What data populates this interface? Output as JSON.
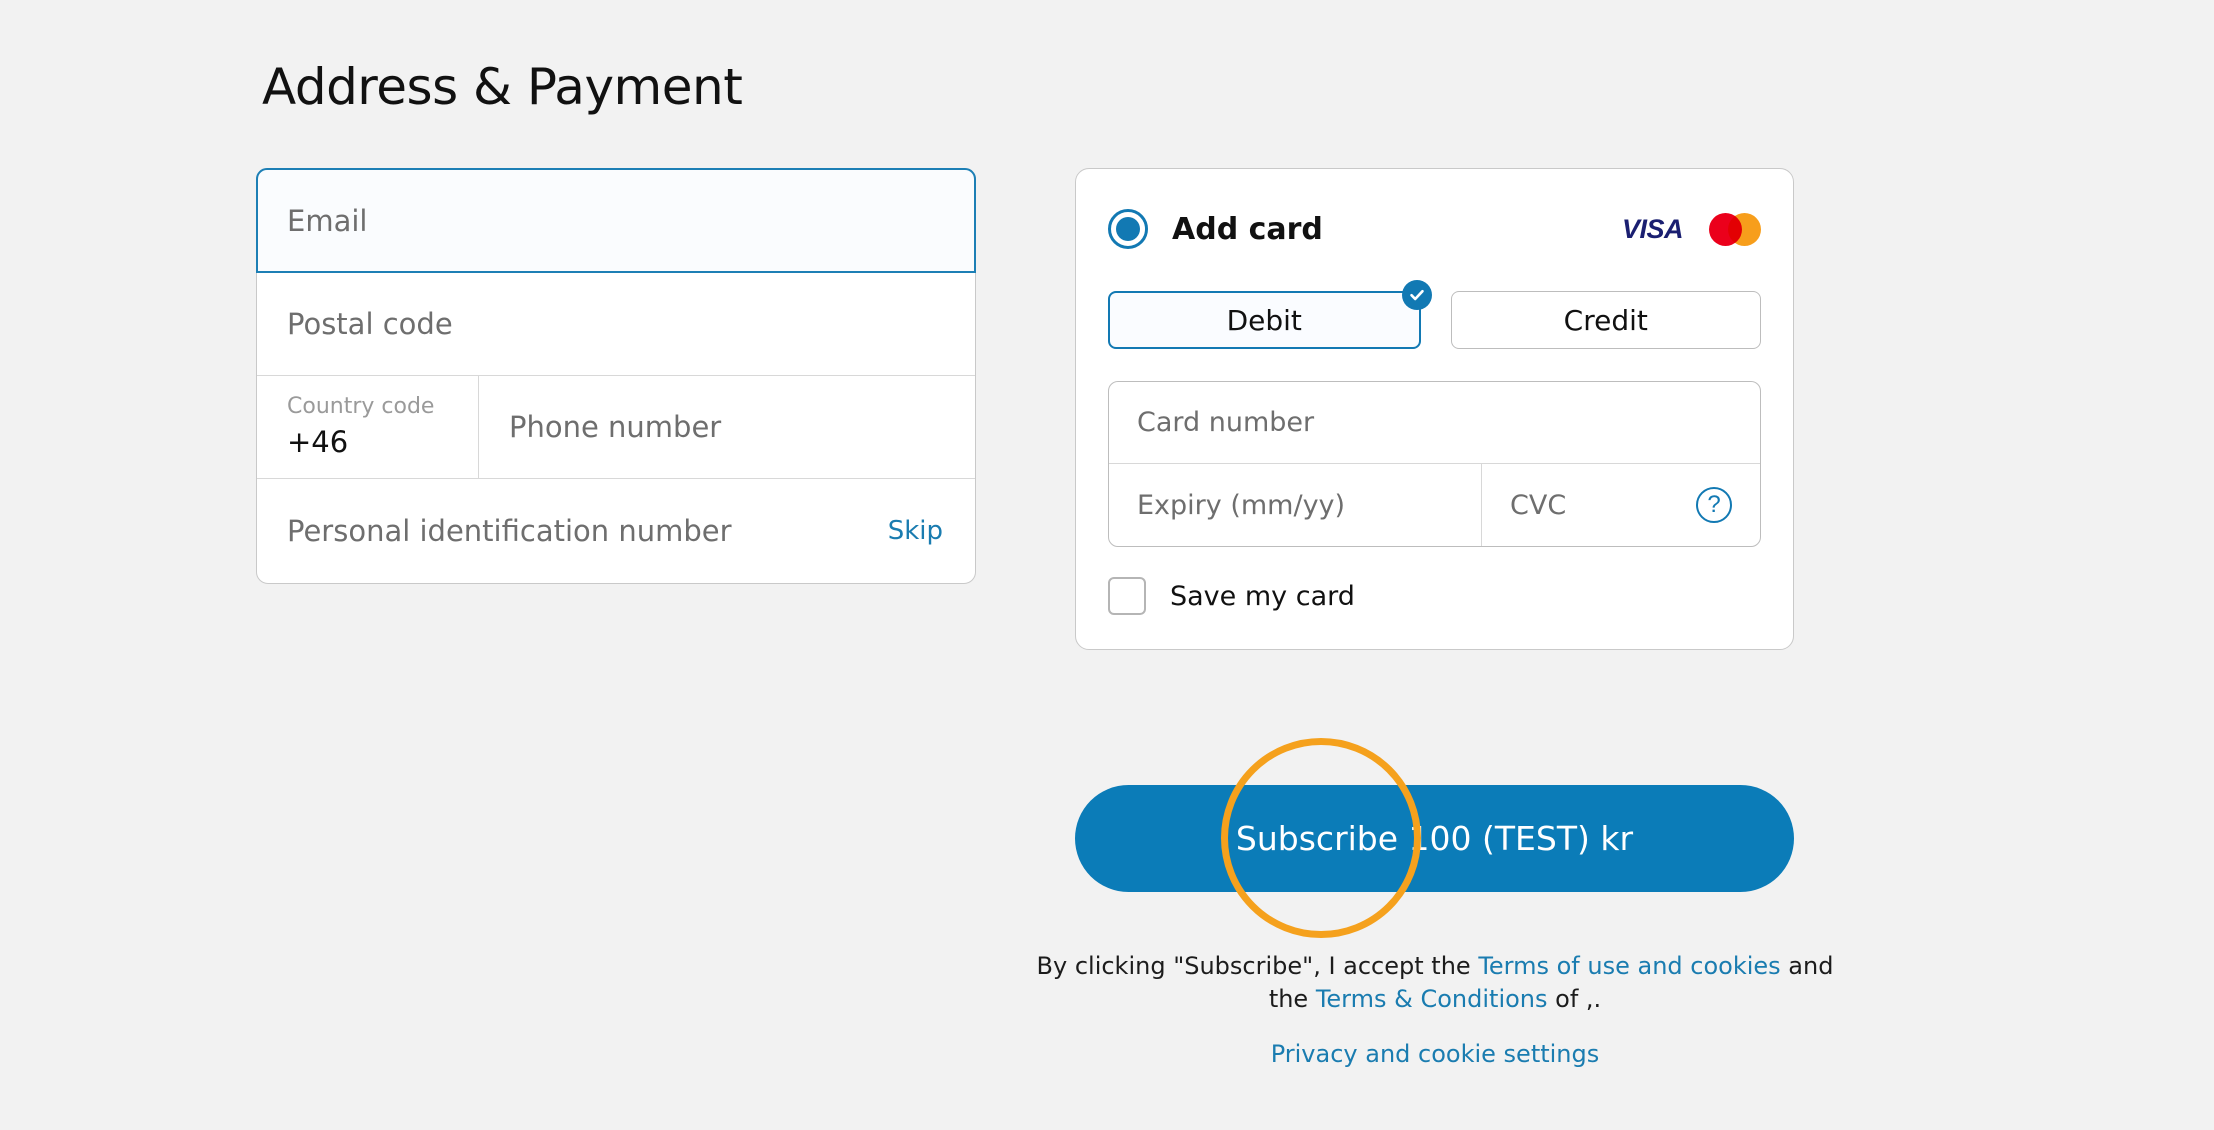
{
  "page": {
    "title": "Address & Payment",
    "background_color": "#f2f2f2",
    "accent_color": "#1279b3",
    "link_color": "#1a7cb0",
    "annotation_color": "#f5a11d"
  },
  "address_form": {
    "email": {
      "placeholder": "Email",
      "value": "",
      "focused": true
    },
    "postal_code": {
      "placeholder": "Postal code",
      "value": ""
    },
    "country_code": {
      "label": "Country code",
      "value": "+46"
    },
    "phone_number": {
      "placeholder": "Phone number",
      "value": ""
    },
    "personal_id": {
      "placeholder": "Personal identification number",
      "value": "",
      "skip_label": "Skip"
    }
  },
  "payment": {
    "option_label": "Add card",
    "option_selected": true,
    "brands": {
      "visa": "VISA",
      "mastercard": "mastercard-icon"
    },
    "card_types": [
      {
        "label": "Debit",
        "selected": true
      },
      {
        "label": "Credit",
        "selected": false
      }
    ],
    "card_number": {
      "placeholder": "Card number",
      "value": ""
    },
    "expiry": {
      "placeholder": "Expiry (mm/yy)",
      "value": ""
    },
    "cvc": {
      "placeholder": "CVC",
      "value": "",
      "help_icon": "question-mark-icon",
      "help_glyph": "?"
    },
    "save_card": {
      "label": "Save my card",
      "checked": false
    }
  },
  "subscribe": {
    "label": "Subscribe 100 (TEST) kr"
  },
  "legal": {
    "prefix": "By clicking \"Subscribe\", I accept the ",
    "terms_of_use_link": "Terms of use and cookies",
    "middle": " and the ",
    "terms_conditions_link": "Terms & Conditions",
    "suffix": " of ,.",
    "privacy_link": "Privacy and cookie settings"
  }
}
